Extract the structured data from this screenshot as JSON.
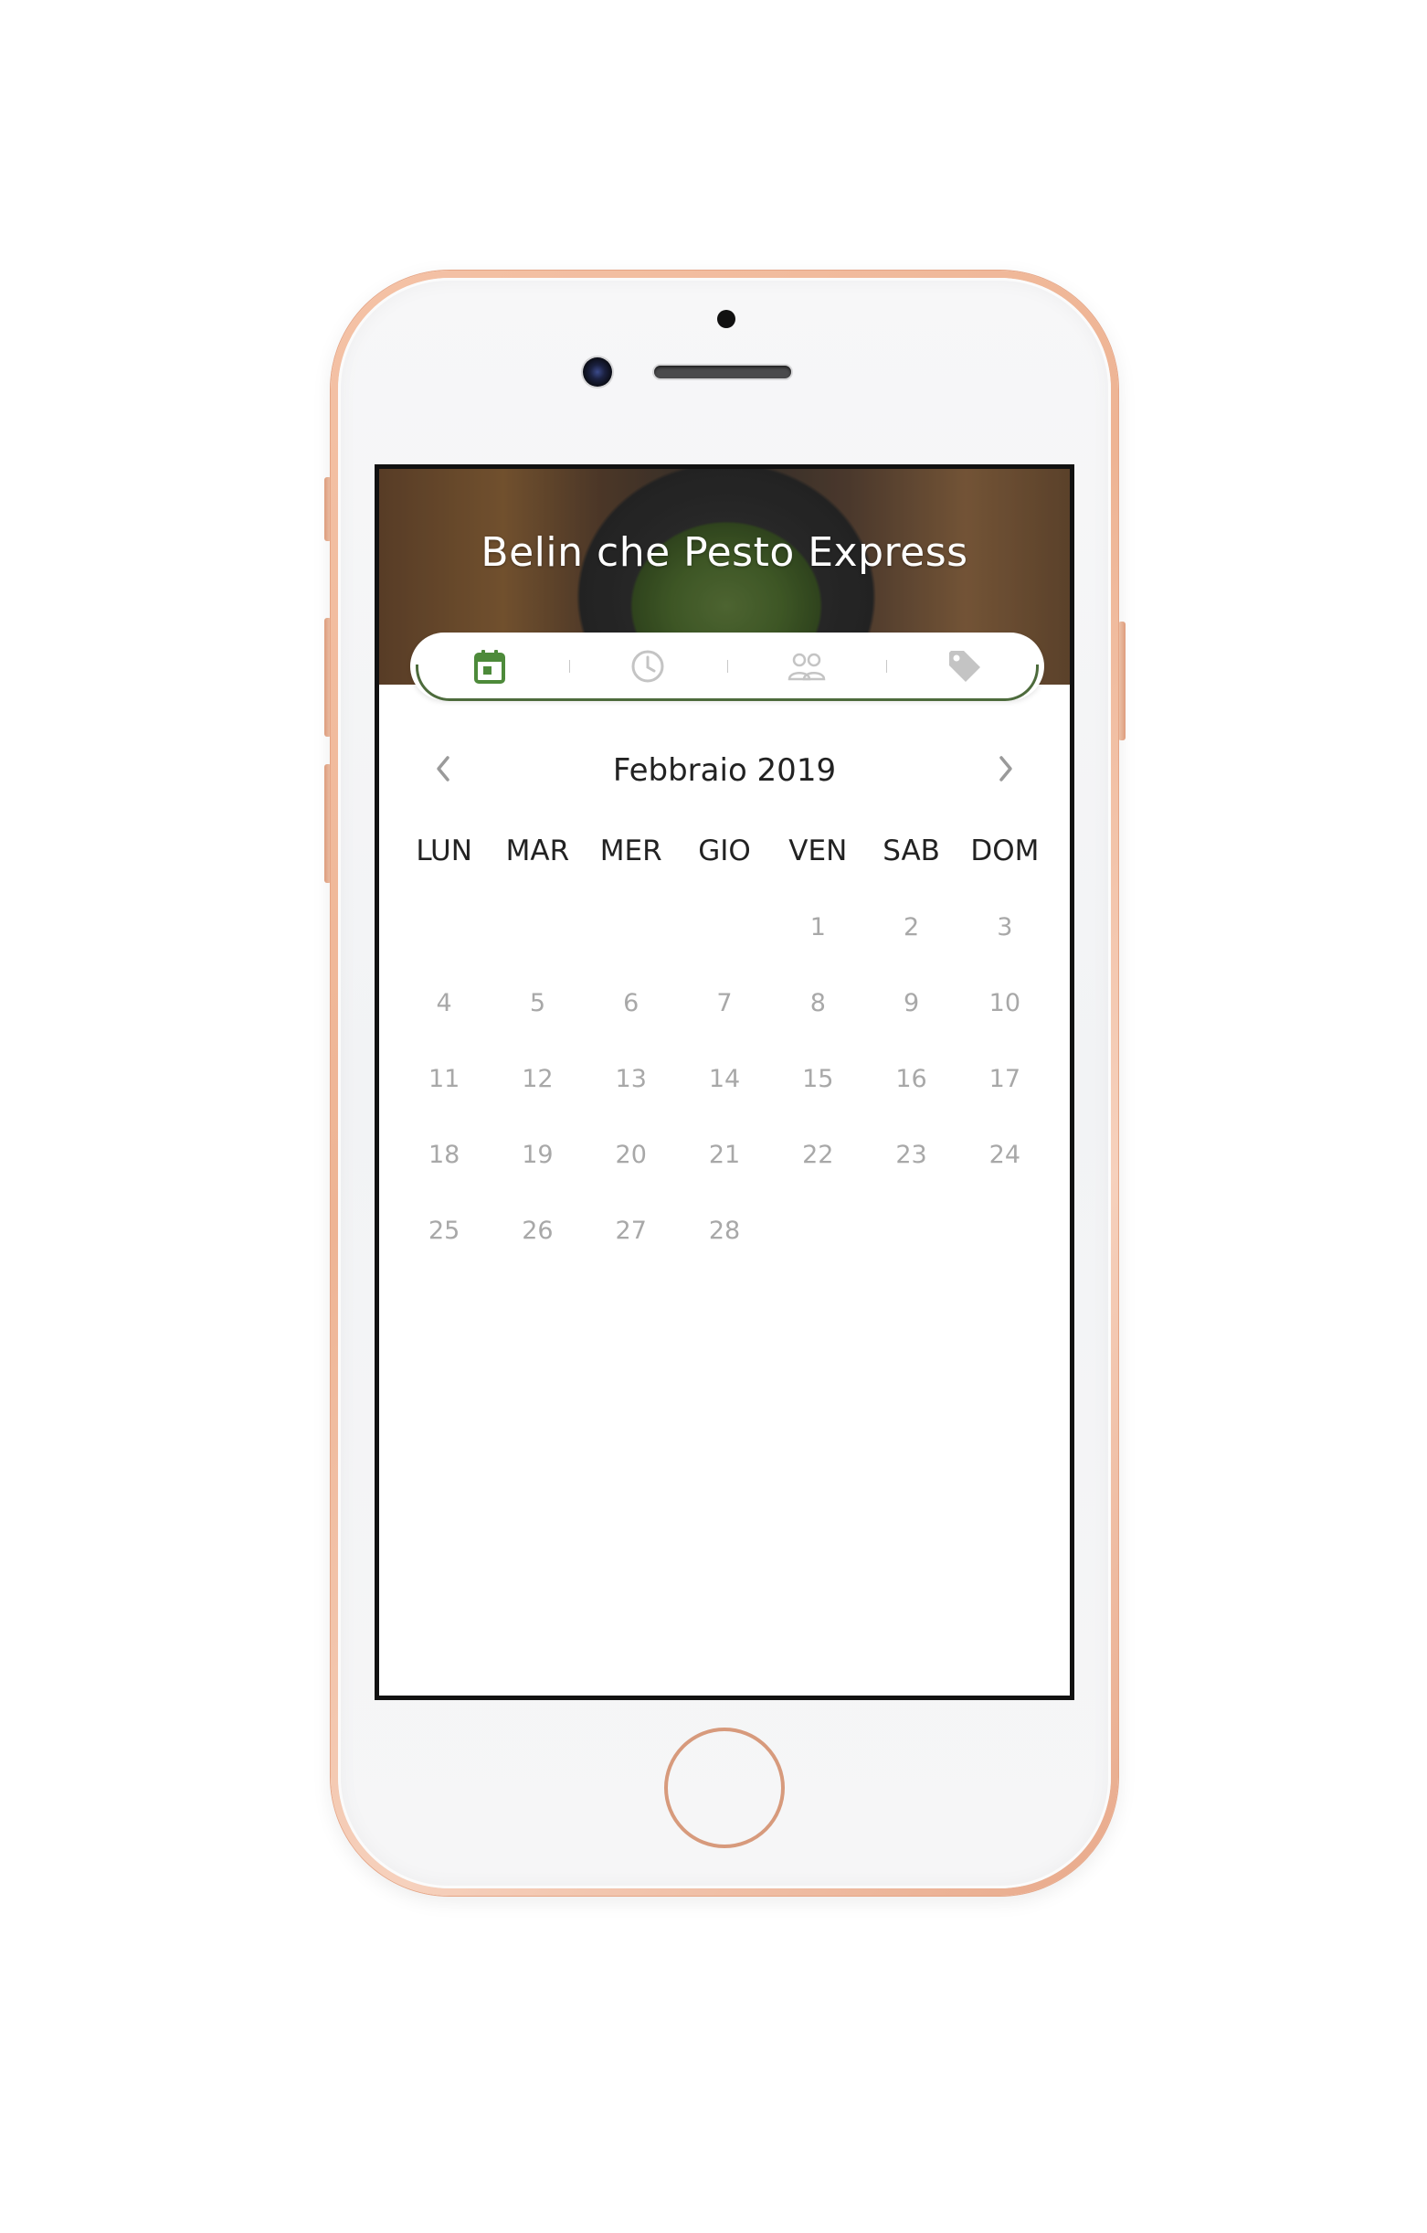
{
  "app": {
    "title": "Belin che Pesto Express"
  },
  "tabs": [
    {
      "icon": "calendar-icon",
      "active": true
    },
    {
      "icon": "clock-icon",
      "active": false
    },
    {
      "icon": "people-icon",
      "active": false
    },
    {
      "icon": "tag-icon",
      "active": false
    }
  ],
  "calendar": {
    "month_label": "Febbraio 2019",
    "prev_icon": "chevron-left-icon",
    "next_icon": "chevron-right-icon",
    "weekdays": [
      "LUN",
      "MAR",
      "MER",
      "GIO",
      "VEN",
      "SAB",
      "DOM"
    ],
    "leading_blanks": 4,
    "days": [
      "1",
      "2",
      "3",
      "4",
      "5",
      "6",
      "7",
      "8",
      "9",
      "10",
      "11",
      "12",
      "13",
      "14",
      "15",
      "16",
      "17",
      "18",
      "19",
      "20",
      "21",
      "22",
      "23",
      "24",
      "25",
      "26",
      "27",
      "28"
    ]
  },
  "colors": {
    "accent_green": "#4d8a3a",
    "tab_border": "#4d6b3c",
    "inactive_icon": "#c4c4c4",
    "day_text": "#a8a8a8",
    "heading_text": "#222222",
    "phone_frame": "#eeb494"
  }
}
